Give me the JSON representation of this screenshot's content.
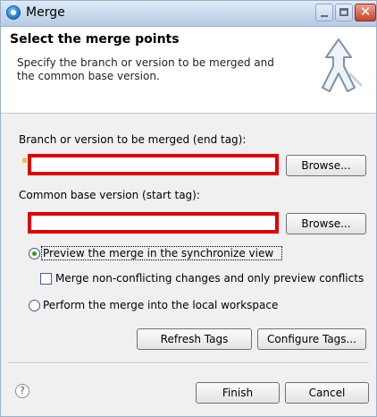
{
  "window": {
    "title": "Merge",
    "minimize_glyph": "",
    "maximize_glyph": "",
    "close_glyph": "✕"
  },
  "header": {
    "title": "Select the merge points",
    "description": "Specify the branch or version to be merged and the common base version.",
    "icon": "merge-arrow-icon"
  },
  "form": {
    "end_tag_label": "Branch or version to be merged (end tag):",
    "end_tag_value": "",
    "start_tag_label": "Common base version (start tag):",
    "start_tag_value": "",
    "browse_label": "Browse..."
  },
  "options": {
    "preview_label": "Preview the merge in the synchronize view",
    "preview_checked": true,
    "nonconflict_label": "Merge non-conflicting changes and only preview conflicts",
    "nonconflict_checked": false,
    "perform_label": "Perform the merge into the local workspace",
    "perform_checked": false
  },
  "actions": {
    "refresh_tags": "Refresh Tags",
    "configure_tags": "Configure Tags...",
    "help_glyph": "?",
    "finish": "Finish",
    "cancel": "Cancel"
  },
  "colors": {
    "highlight_border": "#e00000",
    "titlebar": "#c9d9ee",
    "close_button": "#c8432b"
  }
}
